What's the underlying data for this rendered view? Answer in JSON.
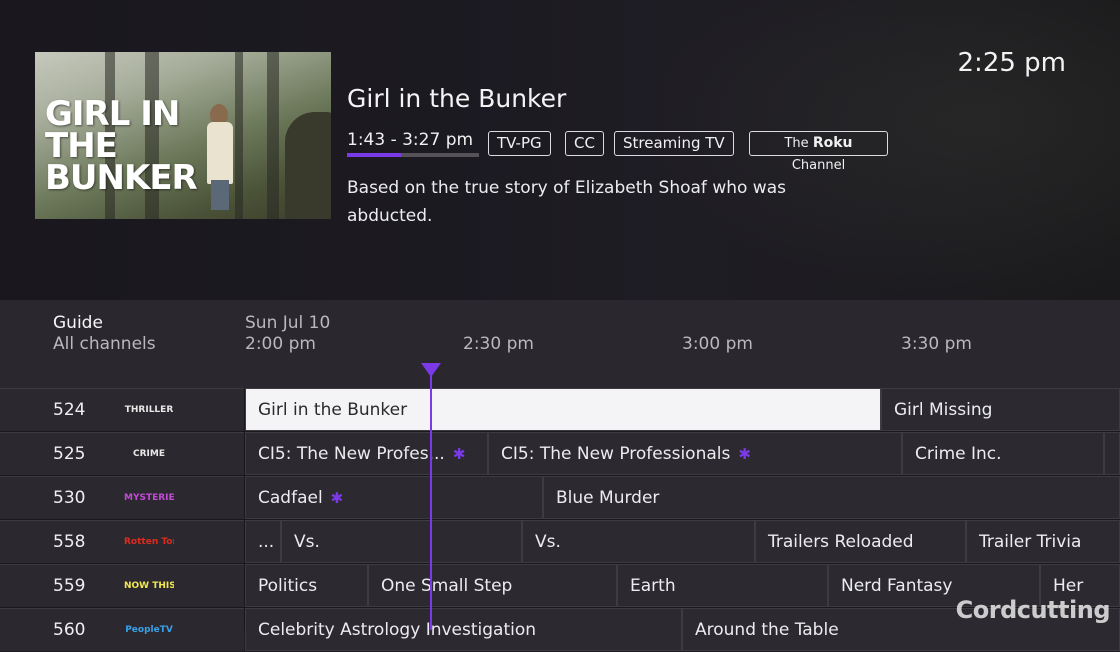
{
  "clock": "2:25 pm",
  "poster": {
    "logo_text": "GIRL IN THE BUNKER"
  },
  "program": {
    "title": "Girl in the Bunker",
    "time_range": "1:43 - 3:27 pm",
    "progress_fraction": 0.41,
    "badges": [
      "TV-PG",
      "CC",
      "Streaming TV"
    ],
    "channel_badge_prefix": "The",
    "channel_badge_brand": "Roku",
    "channel_badge_suffix": "Channel",
    "description": "Based on the true story of Elizabeth Shoaf who was abducted."
  },
  "guide": {
    "title": "Guide",
    "filter": "All channels",
    "date": "Sun Jul 10",
    "times": [
      "2:00 pm",
      "2:30 pm",
      "3:00 pm",
      "3:30 pm"
    ]
  },
  "channels": [
    {
      "number": "524",
      "logo": "THRILLER",
      "logo_color": "#e8e8e8",
      "programs": [
        {
          "title": "Girl in the Bunker",
          "selected": true
        },
        {
          "title": "Girl Missing"
        }
      ]
    },
    {
      "number": "525",
      "logo": "CRIME",
      "logo_color": "#e8e8e8",
      "programs": [
        {
          "title": "CI5: The New Profes...",
          "star": true
        },
        {
          "title": "CI5: The New Professionals",
          "star": true
        },
        {
          "title": "Crime Inc."
        },
        {
          "title": ""
        }
      ]
    },
    {
      "number": "530",
      "logo": "MYSTERIES",
      "logo_color": "#c24bd6",
      "programs": [
        {
          "title": "Cadfael",
          "star": true
        },
        {
          "title": "Blue Murder"
        }
      ]
    },
    {
      "number": "558",
      "logo": "Rotten Tomatoes",
      "logo_color": "#e02a1e",
      "programs": [
        {
          "title": "..."
        },
        {
          "title": "Vs."
        },
        {
          "title": "Vs."
        },
        {
          "title": "Trailers Reloaded"
        },
        {
          "title": "Trailer Trivia"
        }
      ]
    },
    {
      "number": "559",
      "logo": "NOW THIS",
      "logo_color": "#f2e94e",
      "programs": [
        {
          "title": "Politics"
        },
        {
          "title": "One Small Step"
        },
        {
          "title": "Earth"
        },
        {
          "title": "Nerd Fantasy"
        },
        {
          "title": "Her"
        }
      ]
    },
    {
      "number": "560",
      "logo": "PeopleTV",
      "logo_color": "#3aa0e8",
      "programs": [
        {
          "title": "Celebrity Astrology Investigation"
        },
        {
          "title": "Around the Table"
        }
      ]
    }
  ],
  "watermark": "Cordcutting",
  "colors": {
    "accent": "#7a3ae8",
    "selected_bg": "#f4f4f6"
  },
  "icons": {
    "now_marker": "triangle-down-icon",
    "star": "star-icon"
  }
}
